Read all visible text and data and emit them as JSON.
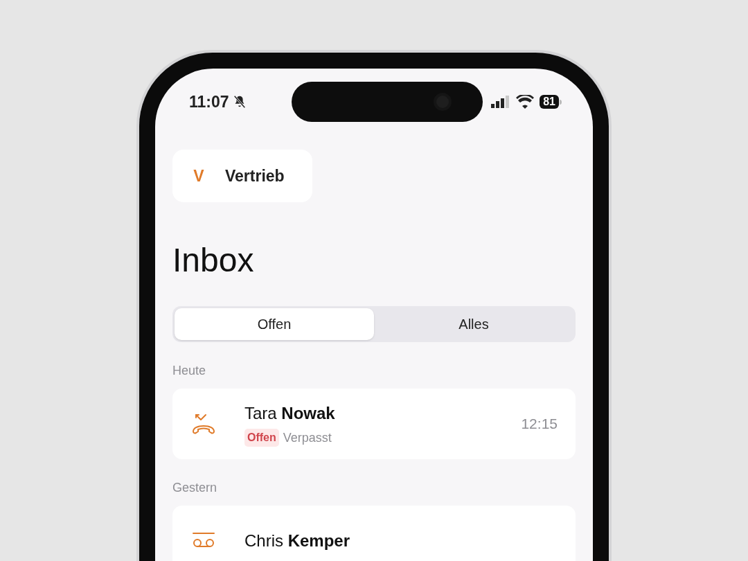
{
  "status_bar": {
    "time": "11:07",
    "silent": true,
    "battery": "81"
  },
  "team": {
    "initial": "V",
    "name": "Vertrieb"
  },
  "title": "Inbox",
  "tabs": [
    {
      "label": "Offen",
      "selected": true
    },
    {
      "label": "Alles",
      "selected": false
    }
  ],
  "sections": [
    {
      "heading": "Heute",
      "items": [
        {
          "kind": "missed",
          "first_name": "Tara",
          "last_name": "Nowak",
          "badge": "Offen",
          "status": "Verpasst",
          "time": "12:15"
        }
      ]
    },
    {
      "heading": "Gestern",
      "items": [
        {
          "kind": "voicemail",
          "first_name": "Chris",
          "last_name": "Kemper"
        }
      ]
    }
  ]
}
